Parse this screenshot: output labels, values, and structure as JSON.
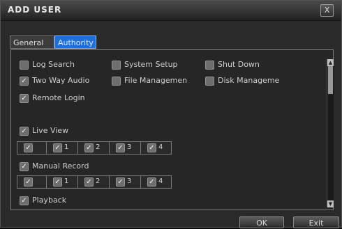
{
  "dialog": {
    "title": "ADD USER",
    "close_label": "X",
    "tabs": [
      {
        "label": "General",
        "active": false
      },
      {
        "label": "Authority",
        "active": true
      }
    ],
    "permissions_row1": [
      {
        "label": "Log Search",
        "checked": false
      },
      {
        "label": "System Setup",
        "checked": false
      },
      {
        "label": "Shut Down",
        "checked": false
      }
    ],
    "permissions_row2": [
      {
        "label": "Two Way Audio",
        "checked": true
      },
      {
        "label": "File Managemen",
        "checked": false
      },
      {
        "label": "Disk Manageme",
        "checked": false
      }
    ],
    "remote_login": {
      "label": "Remote Login",
      "checked": true
    },
    "live_view": {
      "label": "Live View",
      "checked": true,
      "all_checked": true,
      "channels": [
        {
          "num": "1",
          "checked": true
        },
        {
          "num": "2",
          "checked": true
        },
        {
          "num": "3",
          "checked": true
        },
        {
          "num": "4",
          "checked": true
        }
      ]
    },
    "manual_record": {
      "label": "Manual Record",
      "checked": true,
      "all_checked": true,
      "channels": [
        {
          "num": "1",
          "checked": true
        },
        {
          "num": "2",
          "checked": true
        },
        {
          "num": "3",
          "checked": true
        },
        {
          "num": "4",
          "checked": true
        }
      ]
    },
    "playback": {
      "label": "Playback",
      "checked": true
    },
    "buttons": {
      "ok": "OK",
      "exit": "Exit"
    }
  },
  "colors": {
    "background": "#2a2a2a",
    "active_tab": "#1e6fd9",
    "checkbox": "#6e6e6e"
  }
}
